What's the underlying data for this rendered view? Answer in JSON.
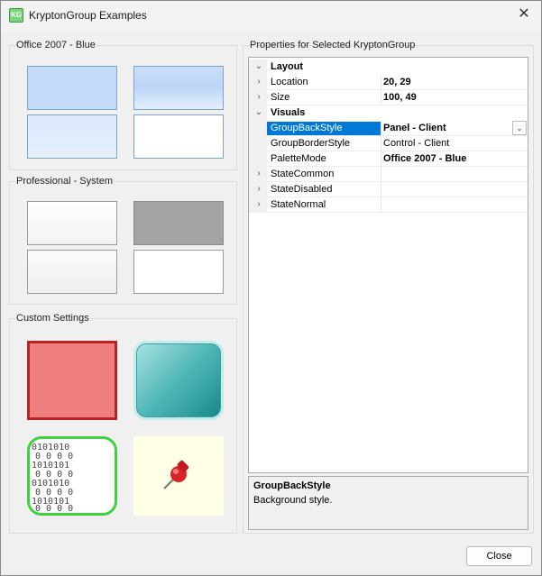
{
  "window": {
    "title": "KryptonGroup Examples",
    "icon": "krypton-app-icon",
    "icon_text": "KG"
  },
  "groups": {
    "office": {
      "label": "Office 2007 - Blue"
    },
    "professional": {
      "label": "Professional - System"
    },
    "custom": {
      "label": "Custom Settings"
    }
  },
  "properties": {
    "header": "Properties for Selected KryptonGroup",
    "rows": [
      {
        "type": "category",
        "name": "Layout",
        "expanded": true
      },
      {
        "type": "property",
        "name": "Location",
        "value": "20, 29",
        "bold": true,
        "expandable": true
      },
      {
        "type": "property",
        "name": "Size",
        "value": "100, 49",
        "bold": true,
        "expandable": true
      },
      {
        "type": "category",
        "name": "Visuals",
        "expanded": true
      },
      {
        "type": "property",
        "name": "GroupBackStyle",
        "value": "Panel - Client",
        "bold": true,
        "selected": true
      },
      {
        "type": "property",
        "name": "GroupBorderStyle",
        "value": "Control - Client",
        "bold": false
      },
      {
        "type": "property",
        "name": "PaletteMode",
        "value": "Office 2007 - Blue",
        "bold": true
      },
      {
        "type": "property",
        "name": "StateCommon",
        "value": "",
        "expandable": true
      },
      {
        "type": "property",
        "name": "StateDisabled",
        "value": "",
        "expandable": true
      },
      {
        "type": "property",
        "name": "StateNormal",
        "value": "",
        "expandable": true
      }
    ]
  },
  "description": {
    "title": "GroupBackStyle",
    "text": "Background style."
  },
  "buttons": {
    "close": "Close"
  },
  "colors": {
    "selection": "#0078d7",
    "office_blue": "#c4dcfa",
    "custom_red": "#ef7f7f",
    "custom_teal": "#4fb6b6"
  }
}
